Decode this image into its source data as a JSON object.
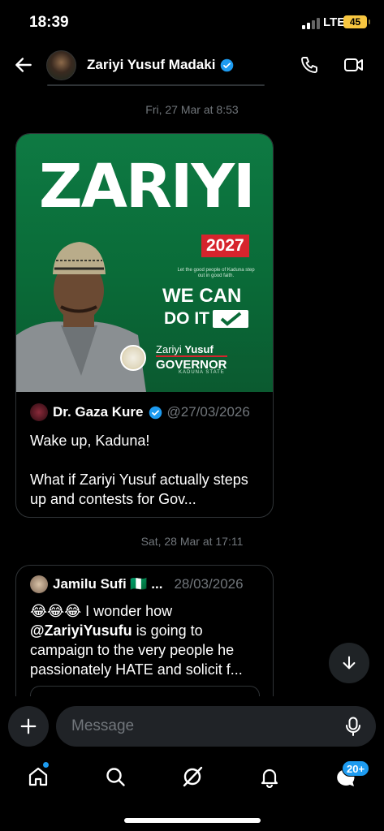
{
  "status_bar": {
    "time": "18:39",
    "network": "LTE",
    "battery": "45"
  },
  "header": {
    "name": "Zariyi Yusuf Madaki"
  },
  "messages": [
    {
      "date": "Fri, 27 Mar at 8:53",
      "poster": {
        "title": "ZARIYI",
        "year": "2027",
        "tagline": "Let the good people of Kaduna step out in good faith.",
        "we_can": "WE CAN",
        "do_it": "DO IT",
        "candidate_first": "Zariyi",
        "candidate_last": "Yusuf",
        "office": "GOVERNOR",
        "state": "KADUNA STATE"
      },
      "quote": {
        "author": "Dr. Gaza Kure",
        "handle": "@27/03/2026",
        "text_line1": "Wake up, Kaduna!",
        "text_line2": "What if Zariyi Yusuf actually steps up and contests for Gov..."
      }
    },
    {
      "date": "Sat, 28 Mar at 17:11",
      "quote": {
        "author": "Jamilu Sufi 🇳🇬 ...",
        "handle": "28/03/2026",
        "emoji": "😂😂😂",
        "text_rest": " I wonder how",
        "mention": "@ZariyiYusufu",
        "text_after": " is going to campaign to the very people he passionately HATE and solicit f..."
      }
    }
  ],
  "composer": {
    "placeholder": "Message"
  },
  "tabbar": {
    "messages_badge": "20+"
  },
  "colors": {
    "accent": "#1d9bf0",
    "poster_green": "#0a6b38",
    "poster_red": "#d6242d"
  }
}
